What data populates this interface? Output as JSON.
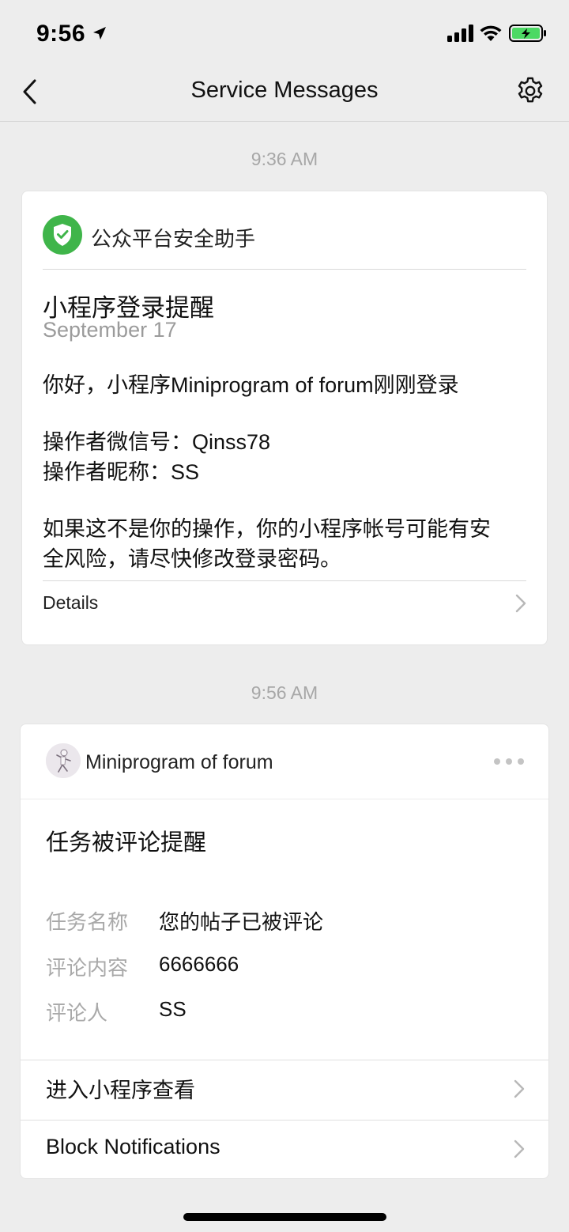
{
  "status_bar": {
    "time": "9:56"
  },
  "nav": {
    "title": "Service Messages"
  },
  "messages": [
    {
      "timestamp": "9:36 AM",
      "source": "公众平台安全助手",
      "title": "小程序登录提醒",
      "date": "September 17",
      "body_line1": "你好，小程序Miniprogram of forum刚刚登录",
      "body_line2a": "操作者微信号：Qinss78",
      "body_line2b": "操作者昵称：SS",
      "body_line3a": "如果这不是你的操作，你的小程序帐号可能有安",
      "body_line3b": "全风险，请尽快修改登录密码。",
      "details_label": "Details"
    },
    {
      "timestamp": "9:56 AM",
      "source": "Miniprogram of forum",
      "title": "任务被评论提醒",
      "fields": [
        {
          "key": "任务名称",
          "value": "您的帖子已被评论"
        },
        {
          "key": "评论内容",
          "value": "6666666"
        },
        {
          "key": "评论人",
          "value": "SS"
        }
      ],
      "action_open": "进入小程序查看",
      "action_block": "Block Notifications"
    }
  ],
  "colors": {
    "background": "#ededed",
    "card": "#ffffff",
    "shield_green": "#3fb54a",
    "battery_green": "#4cd964",
    "muted_text": "#a9a9a9"
  },
  "icons": {
    "back": "chevron-left-icon",
    "settings": "gear-icon",
    "shield": "shield-check-icon",
    "more": "more-dots-icon",
    "chevron": "chevron-right-icon"
  }
}
